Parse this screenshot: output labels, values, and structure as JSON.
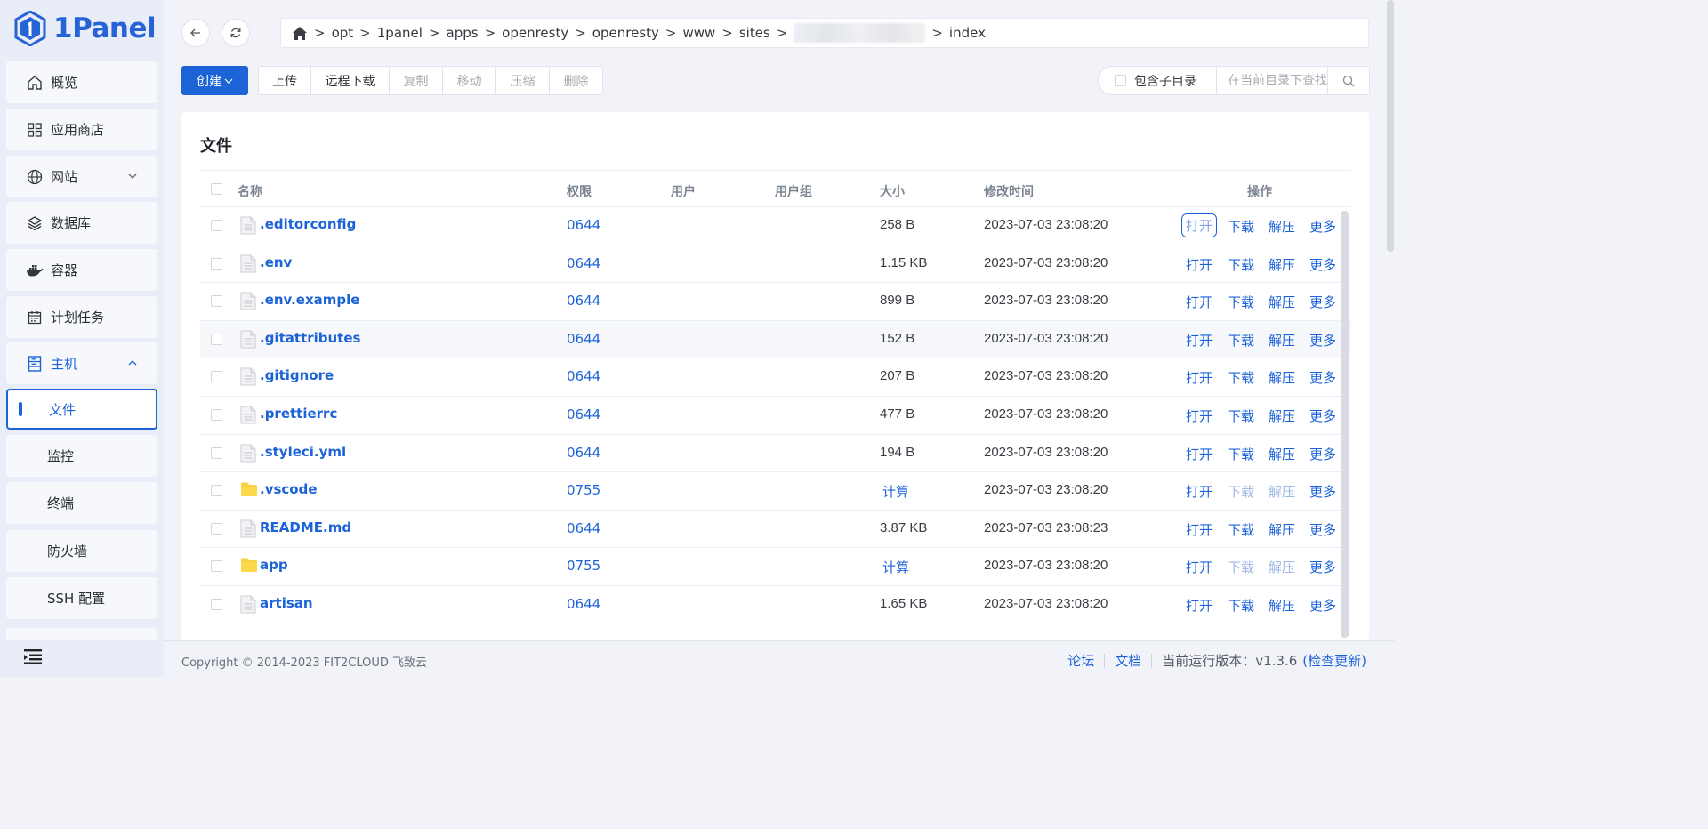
{
  "app": {
    "name": "1Panel"
  },
  "sidebar": {
    "items": [
      {
        "label": "概览"
      },
      {
        "label": "应用商店"
      },
      {
        "label": "网站"
      },
      {
        "label": "数据库"
      },
      {
        "label": "容器"
      },
      {
        "label": "计划任务"
      },
      {
        "label": "主机"
      }
    ],
    "host_sub": [
      {
        "label": "文件"
      },
      {
        "label": "监控"
      },
      {
        "label": "终端"
      },
      {
        "label": "防火墙"
      },
      {
        "label": "SSH 配置"
      }
    ]
  },
  "breadcrumb": {
    "segments": [
      "opt",
      "1panel",
      "apps",
      "openresty",
      "openresty",
      "www",
      "sites"
    ],
    "last": "index",
    "separator": ">"
  },
  "toolbar": {
    "create": "创建",
    "upload": "上传",
    "remote_download": "远程下载",
    "copy": "复制",
    "move": "移动",
    "compress": "压缩",
    "delete": "删除",
    "include_subdir": "包含子目录",
    "search_placeholder": "在当前目录下查找"
  },
  "files": {
    "title": "文件",
    "columns": {
      "name": "名称",
      "perm": "权限",
      "user": "用户",
      "group": "用户组",
      "size": "大小",
      "mtime": "修改时间",
      "actions": "操作"
    },
    "rows": [
      {
        "name": ".editorconfig",
        "type": "file",
        "perm": "0644",
        "size": "258 B",
        "mtime": "2023-07-03 23:08:20"
      },
      {
        "name": ".env",
        "type": "file",
        "perm": "0644",
        "size": "1.15 KB",
        "mtime": "2023-07-03 23:08:20"
      },
      {
        "name": ".env.example",
        "type": "file",
        "perm": "0644",
        "size": "899 B",
        "mtime": "2023-07-03 23:08:20"
      },
      {
        "name": ".gitattributes",
        "type": "file",
        "perm": "0644",
        "size": "152 B",
        "mtime": "2023-07-03 23:08:20"
      },
      {
        "name": ".gitignore",
        "type": "file",
        "perm": "0644",
        "size": "207 B",
        "mtime": "2023-07-03 23:08:20"
      },
      {
        "name": ".prettierrc",
        "type": "file",
        "perm": "0644",
        "size": "477 B",
        "mtime": "2023-07-03 23:08:20"
      },
      {
        "name": ".styleci.yml",
        "type": "file",
        "perm": "0644",
        "size": "194 B",
        "mtime": "2023-07-03 23:08:20"
      },
      {
        "name": ".vscode",
        "type": "folder",
        "perm": "0755",
        "size": "计算",
        "mtime": "2023-07-03 23:08:20"
      },
      {
        "name": "README.md",
        "type": "file",
        "perm": "0644",
        "size": "3.87 KB",
        "mtime": "2023-07-03 23:08:23"
      },
      {
        "name": "app",
        "type": "folder",
        "perm": "0755",
        "size": "计算",
        "mtime": "2023-07-03 23:08:20"
      },
      {
        "name": "artisan",
        "type": "file",
        "perm": "0644",
        "size": "1.65 KB",
        "mtime": "2023-07-03 23:08:20"
      }
    ],
    "actions": {
      "open": "打开",
      "download": "下载",
      "extract": "解压",
      "more": "更多"
    }
  },
  "footer": {
    "copyright": "Copyright © 2014-2023 FIT2CLOUD 飞致云",
    "forum": "论坛",
    "docs": "文档",
    "version": "当前运行版本：v1.3.6",
    "check_update": "(检查更新)"
  },
  "colors": {
    "primary": "#1d63d8",
    "sidebar_bg": "#e9edf8",
    "page_bg": "#f1f3f8"
  }
}
